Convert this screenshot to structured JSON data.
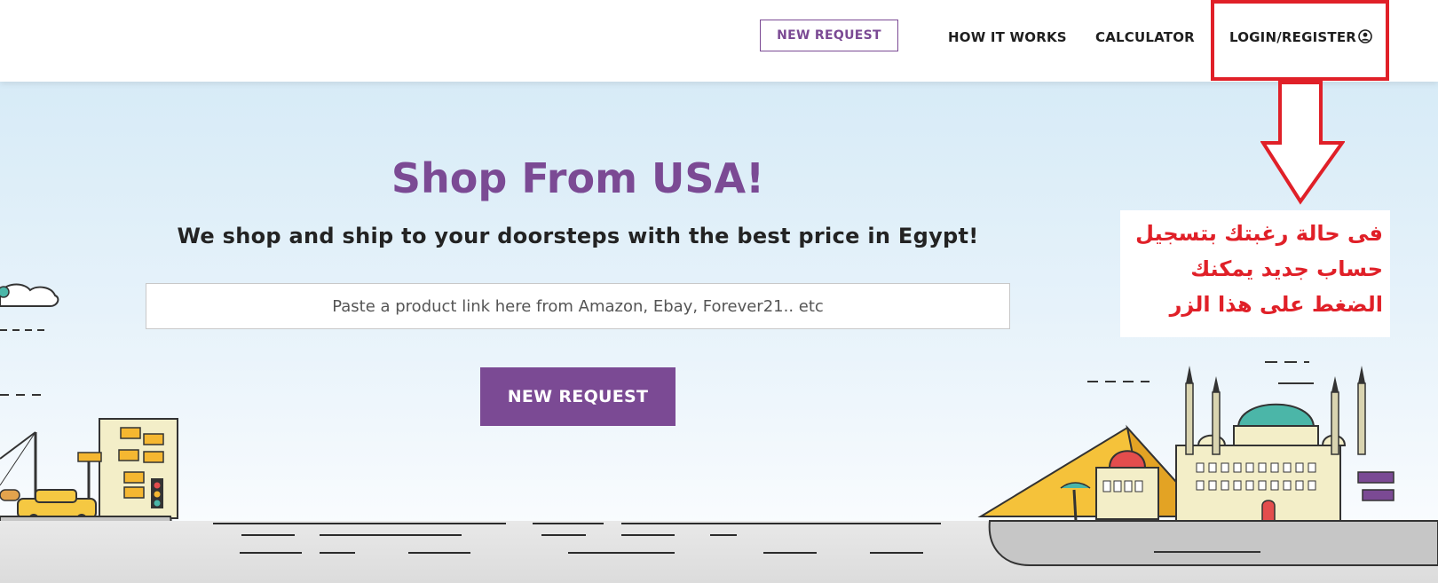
{
  "header": {
    "new_request_label": "NEW REQUEST",
    "nav": [
      {
        "label": "HOW IT WORKS"
      },
      {
        "label": "CALCULATOR"
      },
      {
        "label": "LOGIN/REGISTER"
      }
    ],
    "user_icon": "user-circle-icon"
  },
  "hero": {
    "title": "Shop From USA!",
    "subtitle": "We shop and ship to your doorsteps with the best price in Egypt!",
    "search_placeholder": "Paste a product link here from Amazon, Ebay, Forever21.. etc",
    "cta_label": "NEW REQUEST"
  },
  "annotation": {
    "lines": [
      "فى حالة رغبتك بتسجيل",
      "حساب جديد يمكنك",
      "الضغط على هذا الزر"
    ],
    "color": "#e02028"
  },
  "colors": {
    "brand_purple": "#7b4a94",
    "annotation_red": "#e02028"
  }
}
